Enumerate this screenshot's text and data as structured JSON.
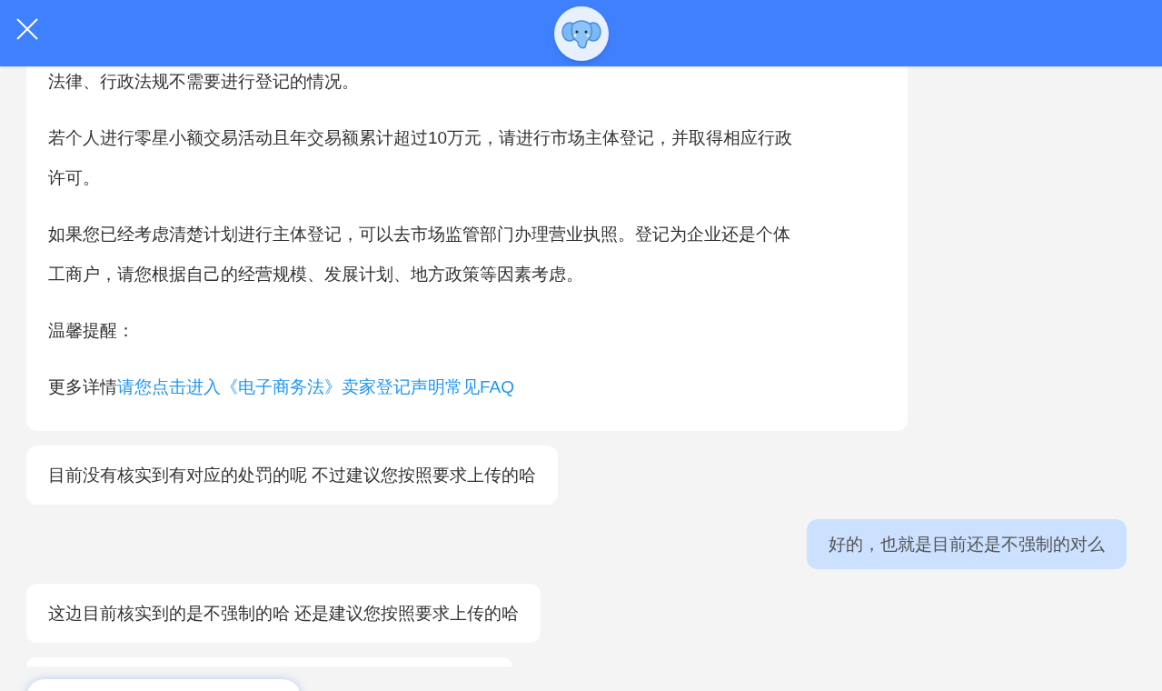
{
  "messages": [
    {
      "kind": "bot_card",
      "paragraphs": [
        {
          "text": "法律、行政法规不需要进行登记的情况。"
        },
        {
          "text": "若个人进行零星小额交易活动且年交易额累计超过10万元，请进行市场主体登记，并取得相应行政许可。"
        },
        {
          "text": "如果您已经考虑清楚计划进行主体登记，可以去市场监管部门办理营业执照。登记为企业还是个体工商户，请您根据自己的经营规模、发展计划、地方政策等因素考虑。"
        },
        {
          "text": "温馨提醒："
        },
        {
          "text": "更多详情",
          "link": "请您点击进入《电子商务法》卖家登记声明常见FAQ"
        }
      ]
    },
    {
      "kind": "bot_bubble",
      "text": "目前没有核实到有对应的处罚的呢 不过建议您按照要求上传的哈"
    },
    {
      "kind": "user_bubble",
      "text": "好的，也就是目前还是不强制的对么"
    },
    {
      "kind": "bot_bubble",
      "text": "这边目前核实到的是不强制的哈 还是建议您按照要求上传的哈"
    },
    {
      "kind": "bot_partial"
    }
  ],
  "bottom": {
    "kind": "pill"
  }
}
